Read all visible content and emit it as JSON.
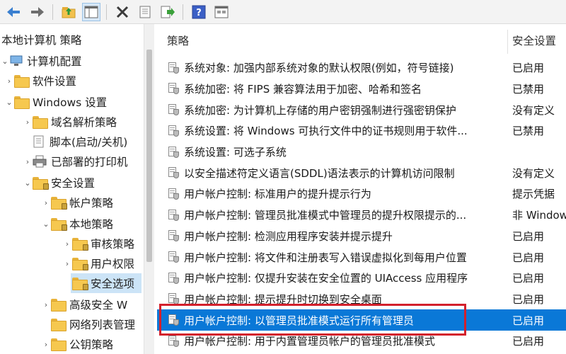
{
  "toolbar": {
    "buttons": [
      "back-icon",
      "forward-icon",
      "up-folder-icon",
      "show-hide-tree-icon",
      "delete-icon",
      "properties-icon",
      "export-list-icon",
      "help-icon",
      "view-icon"
    ]
  },
  "tree": {
    "items": [
      {
        "label": "本地计算机 策略",
        "level": 0
      },
      {
        "label": "计算机配置",
        "level": 1
      },
      {
        "label": "软件设置",
        "level": 2
      },
      {
        "label": "Windows 设置",
        "level": 2
      },
      {
        "label": "域名解析策略",
        "level": 3
      },
      {
        "label": "脚本(启动/关机)",
        "level": 3
      },
      {
        "label": "已部署的打印机",
        "level": 3
      },
      {
        "label": "安全设置",
        "level": 3
      },
      {
        "label": "帐户策略",
        "level": 4
      },
      {
        "label": "本地策略",
        "level": 4
      },
      {
        "label": "审核策略",
        "level": 5
      },
      {
        "label": "用户权限",
        "level": 5
      },
      {
        "label": "安全选项",
        "level": 5
      },
      {
        "label": "高级安全 W",
        "level": 4
      },
      {
        "label": "网络列表管理",
        "level": 4
      },
      {
        "label": "公钥策略",
        "level": 4
      }
    ]
  },
  "list": {
    "col_policy": "策略",
    "col_setting": "安全设置",
    "rows": [
      {
        "name": "系统对象: 加强内部系统对象的默认权限(例如，符号链接)",
        "value": "已启用"
      },
      {
        "name": "系统加密: 将 FIPS 兼容算法用于加密、哈希和签名",
        "value": "已禁用"
      },
      {
        "name": "系统加密: 为计算机上存储的用户密钥强制进行强密钥保护",
        "value": "没有定义"
      },
      {
        "name": "系统设置: 将 Windows 可执行文件中的证书规则用于软件...",
        "value": "已禁用"
      },
      {
        "name": "系统设置: 可选子系统",
        "value": ""
      },
      {
        "name": "以安全描述符定义语言(SDDL)语法表示的计算机访问限制",
        "value": "没有定义"
      },
      {
        "name": "用户帐户控制: 标准用户的提升提示行为",
        "value": "提示凭据"
      },
      {
        "name": "用户帐户控制: 管理员批准模式中管理员的提升权限提示的...",
        "value": "非 Windows"
      },
      {
        "name": "用户帐户控制: 检测应用程序安装并提示提升",
        "value": "已启用"
      },
      {
        "name": "用户帐户控制: 将文件和注册表写入错误虚拟化到每用户位置",
        "value": "已启用"
      },
      {
        "name": "用户帐户控制: 仅提升安装在安全位置的 UIAccess 应用程序",
        "value": "已启用"
      },
      {
        "name": "用户帐户控制: 提示提升时切换到安全桌面",
        "value": "已启用"
      },
      {
        "name": "用户帐户控制: 以管理员批准模式运行所有管理员",
        "value": "已启用"
      },
      {
        "name": "用户帐户控制: 用于内置管理员帐户的管理员批准模式",
        "value": "已启用"
      }
    ],
    "selected_index": 12
  }
}
